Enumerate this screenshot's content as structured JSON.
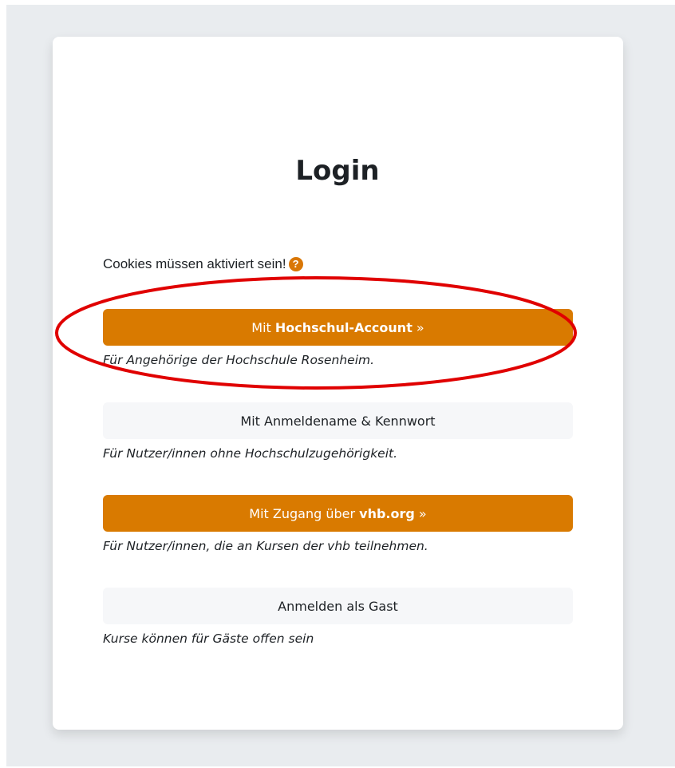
{
  "login": {
    "title": "Login",
    "cookies_notice": "Cookies müssen aktiviert sein!",
    "help_icon_glyph": "?"
  },
  "options": [
    {
      "btn_prefix": "Mit ",
      "btn_bold": "Hochschul-Account",
      "btn_suffix": " »",
      "description": "Für Angehörige der Hochschule Rosenheim.",
      "style": "primary"
    },
    {
      "btn_label": "Mit Anmeldename & Kennwort",
      "description": "Für Nutzer/innen ohne Hochschulzugehörigkeit.",
      "style": "secondary"
    },
    {
      "btn_prefix": "Mit Zugang über ",
      "btn_bold": "vhb.org",
      "btn_suffix": " »",
      "description": "Für Nutzer/innen, die an Kursen der vhb teilnehmen.",
      "style": "primary"
    },
    {
      "btn_label": "Anmelden als Gast",
      "description": "Kurse können für Gäste offen sein",
      "style": "secondary"
    }
  ],
  "colors": {
    "accent": "#d97a00",
    "secondary_button": "#f6f7f9",
    "page_background": "#e9ecef",
    "annotation_ring": "#e00000"
  },
  "annotation": {
    "shape": "ellipse",
    "target": "hochschul-account-button"
  }
}
